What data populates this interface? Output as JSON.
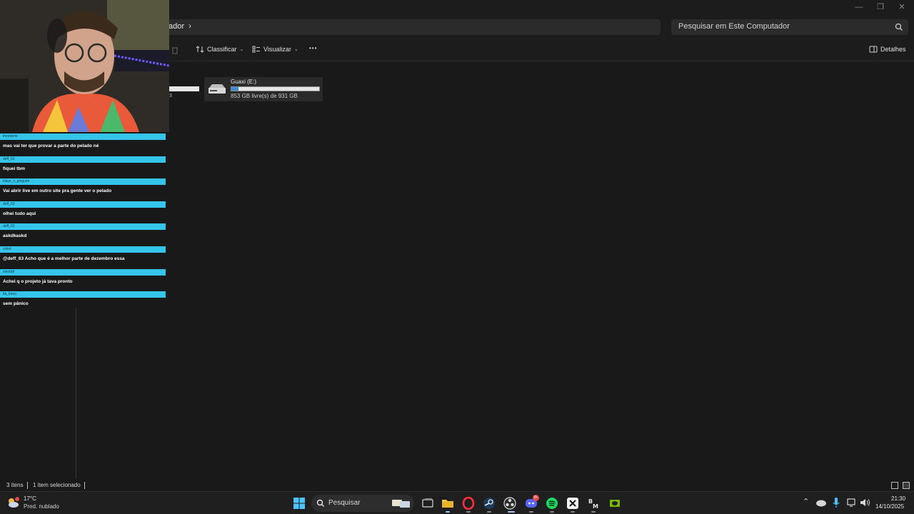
{
  "address": {
    "breadcrumb": "ador",
    "search_placeholder": "Pesquisar em Este Computador"
  },
  "toolbar": {
    "sort_label": "Classificar",
    "view_label": "Visualizar",
    "more_label": "•••",
    "details_label": "Detalhes"
  },
  "drive": {
    "name": "Guaxi (E:)",
    "free_text": "853 GB livre(s) de 931 GB",
    "used_fraction": 0.084,
    "partial_text": "3"
  },
  "chat": {
    "messages": [
      {
        "user": "lmonterie",
        "text": "mas vai ter que provar a parte do pelado né"
      },
      {
        "user": "deff_63",
        "text": "fiquei tbm"
      },
      {
        "user": "klaus_x_pinguim",
        "text": "Vai abrir live em outro site pra gente ver o pelado"
      },
      {
        "user": "deff_63",
        "text": "olhei tudo aqui"
      },
      {
        "user": "deff_63",
        "text": "askdkaskd"
      },
      {
        "user": "zinkit",
        "text": "@deff_63 Acho que é a melhor parte de dezembro essa"
      },
      {
        "user": "xinoddi",
        "text": "Achei q o projeto já tava pronto"
      },
      {
        "user": "tla_lmno",
        "text": "sem pânico"
      }
    ]
  },
  "status": {
    "items_count": "3 itens",
    "selected": "1 item selecionado"
  },
  "taskbar": {
    "weather_temp": "17°C",
    "weather_desc": "Pred. nublado",
    "search_label": "Pesquisar",
    "time": "21:30",
    "date": "14/10/2025",
    "discord_badge": "9+"
  },
  "colors": {
    "chat_header": "#36c5ea",
    "drive_fill": "#3c8fd6",
    "background": "#191919"
  }
}
